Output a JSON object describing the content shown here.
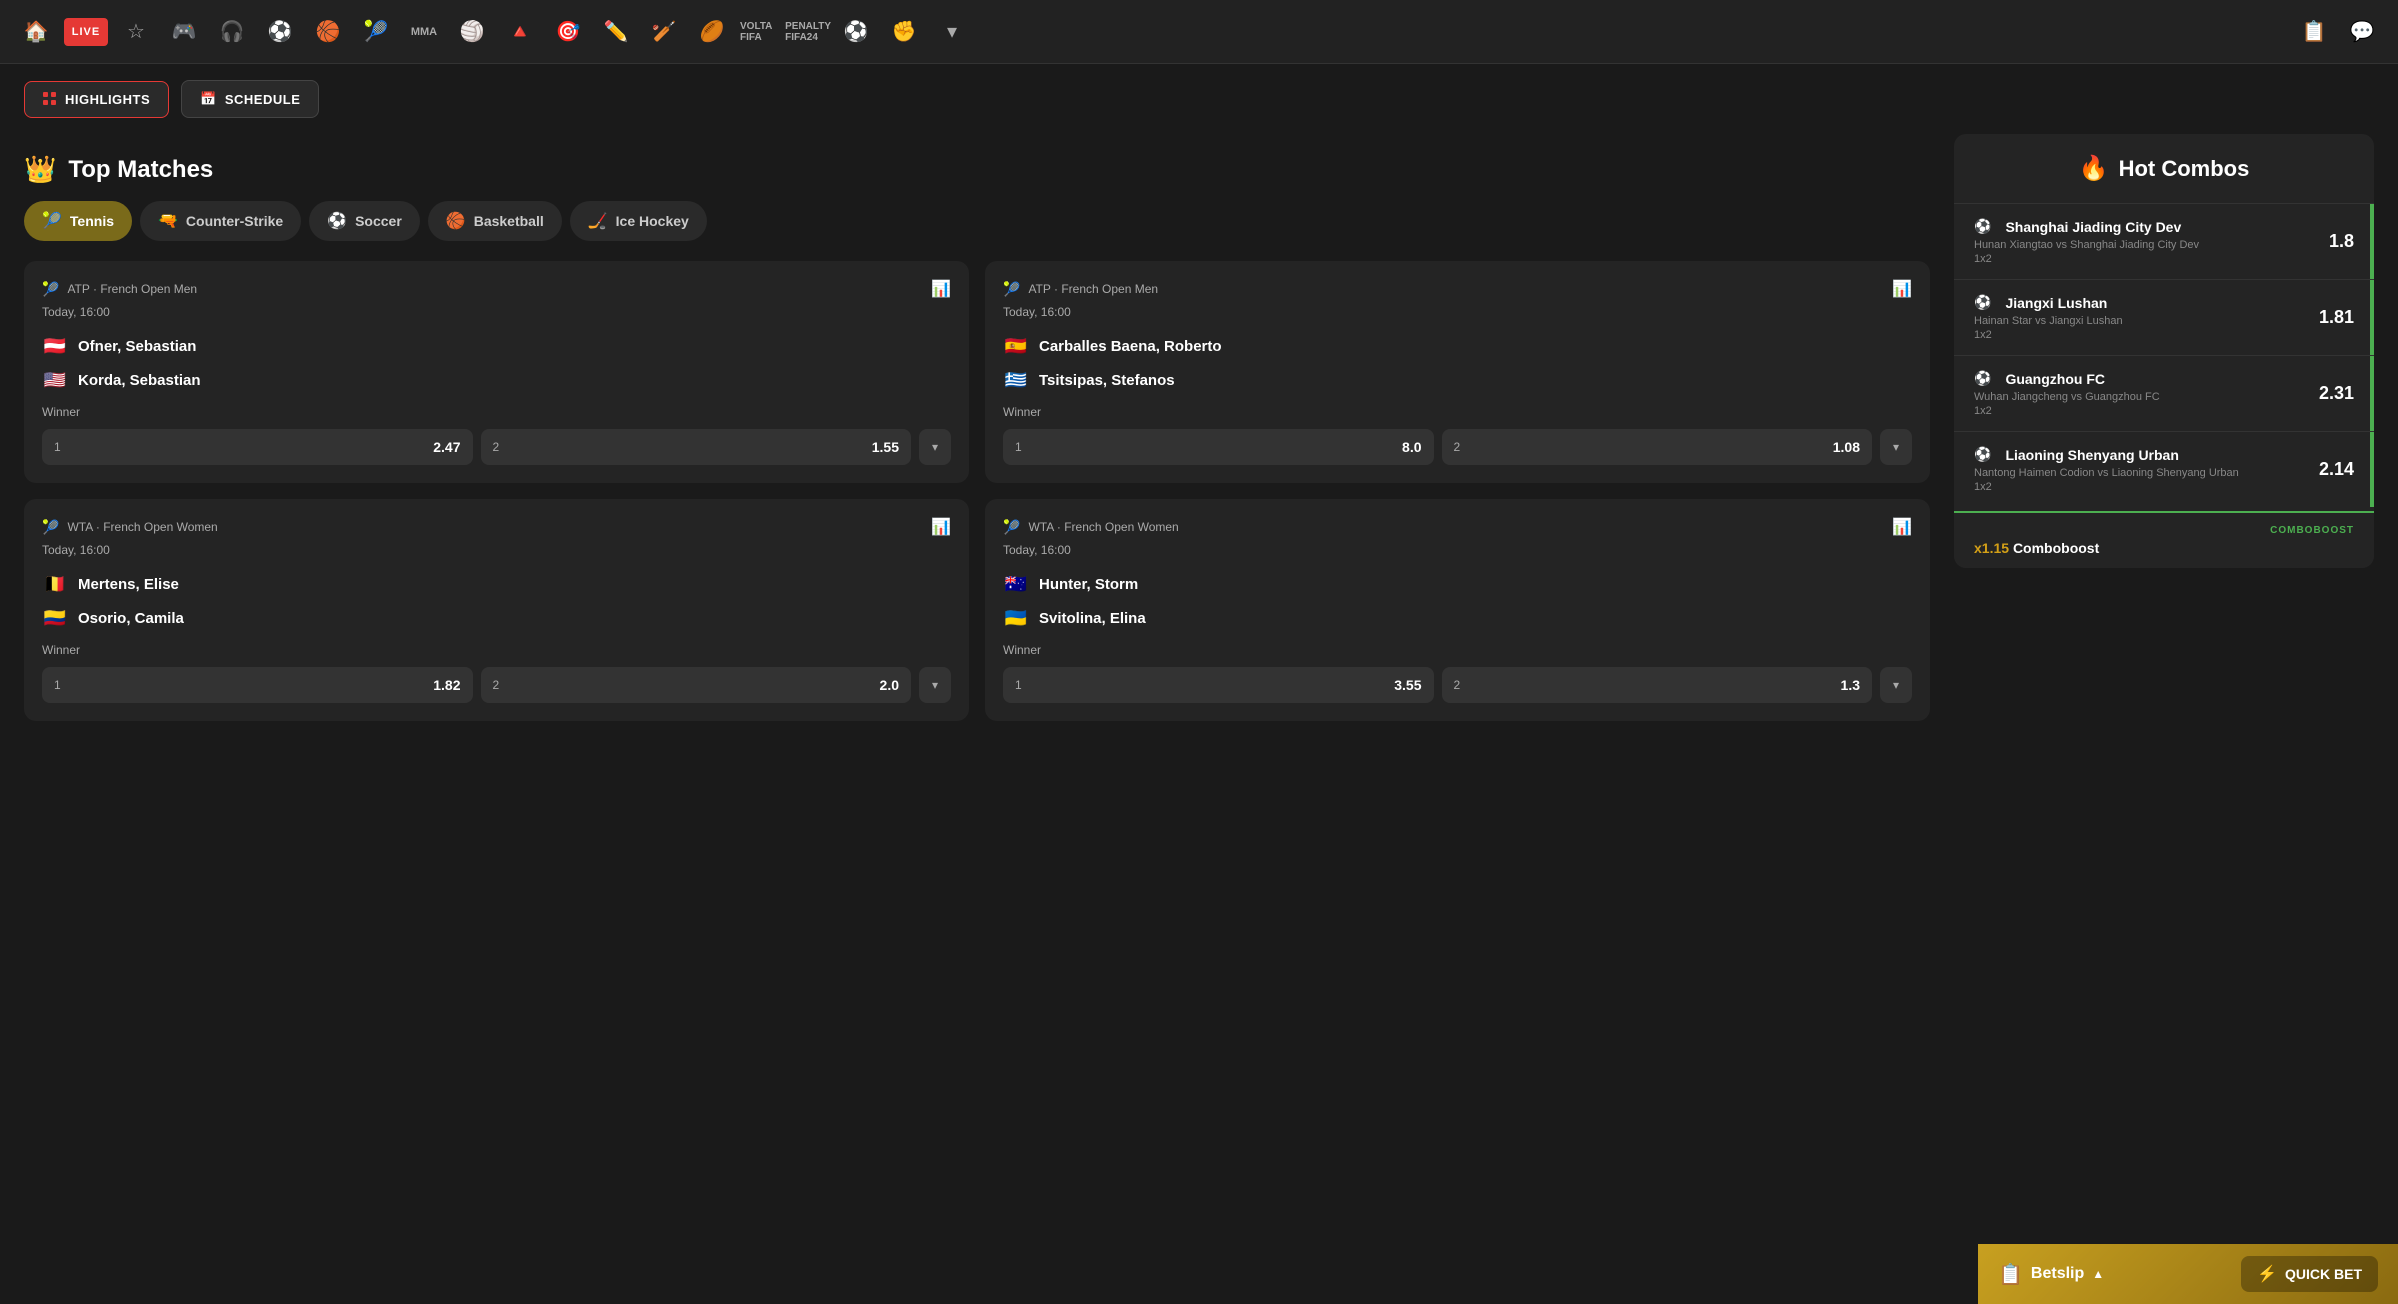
{
  "nav": {
    "live_label": "LIVE",
    "icons": [
      {
        "name": "home-icon",
        "symbol": "🏠"
      },
      {
        "name": "favorites-icon",
        "symbol": "☆"
      },
      {
        "name": "esports-icon",
        "symbol": "🎮"
      },
      {
        "name": "headset-icon",
        "symbol": "🎧"
      },
      {
        "name": "soccer-icon",
        "symbol": "⚽"
      },
      {
        "name": "basketball-icon",
        "symbol": "🏀"
      },
      {
        "name": "tennis-icon",
        "symbol": "🎾"
      },
      {
        "name": "mma-icon",
        "symbol": "MMA"
      },
      {
        "name": "volleyball-icon",
        "symbol": "🏐"
      },
      {
        "name": "snooker-icon",
        "symbol": "🔺"
      },
      {
        "name": "darts-icon",
        "symbol": "🎯"
      },
      {
        "name": "hockey-nav-icon",
        "symbol": "🏒"
      },
      {
        "name": "cricket-icon",
        "symbol": "🏏"
      },
      {
        "name": "rugby-icon",
        "symbol": "🏉"
      },
      {
        "name": "volta-icon",
        "symbol": "VOLTA"
      },
      {
        "name": "penalty-icon",
        "symbol": "FIFA24"
      },
      {
        "name": "extra-icon",
        "symbol": "⚽"
      },
      {
        "name": "fist-icon",
        "symbol": "✊"
      },
      {
        "name": "more-icon",
        "symbol": "▾"
      }
    ],
    "right_icons": [
      {
        "name": "betslip-nav-icon",
        "symbol": "📋"
      },
      {
        "name": "chat-icon",
        "symbol": "💬"
      }
    ]
  },
  "subheader": {
    "highlights_label": "HIGHLIGHTS",
    "schedule_label": "SCHEDULE"
  },
  "top_matches": {
    "title": "Top Matches",
    "tabs": [
      {
        "id": "tennis",
        "label": "Tennis",
        "icon": "🎾",
        "active": true
      },
      {
        "id": "counter-strike",
        "label": "Counter-Strike",
        "icon": "🔫",
        "active": false
      },
      {
        "id": "soccer",
        "label": "Soccer",
        "icon": "⚽",
        "active": false
      },
      {
        "id": "basketball",
        "label": "Basketball",
        "icon": "🏀",
        "active": false
      },
      {
        "id": "ice-hockey",
        "label": "Ice Hockey",
        "icon": "🏒",
        "active": false
      }
    ]
  },
  "matches": [
    {
      "id": "match-1",
      "league": "ATP · French Open Men",
      "time": "Today, 16:00",
      "player1": {
        "name": "Ofner, Sebastian",
        "flag": "🇦🇹"
      },
      "player2": {
        "name": "Korda, Sebastian",
        "flag": "🇺🇸"
      },
      "market": "Winner",
      "odds": [
        {
          "label": "1",
          "value": "2.47"
        },
        {
          "label": "2",
          "value": "1.55"
        }
      ]
    },
    {
      "id": "match-2",
      "league": "ATP · French Open Men",
      "time": "Today, 16:00",
      "player1": {
        "name": "Carballes Baena, Roberto",
        "flag": "🇪🇸"
      },
      "player2": {
        "name": "Tsitsipas, Stefanos",
        "flag": "🇬🇷"
      },
      "market": "Winner",
      "odds": [
        {
          "label": "1",
          "value": "8.0"
        },
        {
          "label": "2",
          "value": "1.08"
        }
      ]
    },
    {
      "id": "match-3",
      "league": "WTA · French Open Women",
      "time": "Today, 16:00",
      "player1": {
        "name": "Mertens, Elise",
        "flag": "🇧🇪"
      },
      "player2": {
        "name": "Osorio, Camila",
        "flag": "🇨🇴"
      },
      "market": "Winner",
      "odds": [
        {
          "label": "1",
          "value": "1.82"
        },
        {
          "label": "2",
          "value": "2.0"
        }
      ]
    },
    {
      "id": "match-4",
      "league": "WTA · French Open Women",
      "time": "Today, 16:00",
      "player1": {
        "name": "Hunter, Storm",
        "flag": "🇦🇺"
      },
      "player2": {
        "name": "Svitolina, Elina",
        "flag": "🇺🇦"
      },
      "market": "Winner",
      "odds": [
        {
          "label": "1",
          "value": "3.55"
        },
        {
          "label": "2",
          "value": "1.3"
        }
      ]
    }
  ],
  "hot_combos": {
    "title": "Hot Combos",
    "items": [
      {
        "team": "Shanghai Jiading City Dev",
        "match": "Hunan Xiangtao vs Shanghai Jiading City Dev",
        "type": "1x2",
        "odds": "1.8"
      },
      {
        "team": "Jiangxi Lushan",
        "match": "Hainan Star vs Jiangxi Lushan",
        "type": "1x2",
        "odds": "1.81"
      },
      {
        "team": "Guangzhou FC",
        "match": "Wuhan Jiangcheng vs Guangzhou FC",
        "type": "1x2",
        "odds": "2.31"
      },
      {
        "team": "Liaoning Shenyang Urban",
        "match": "Nantong Haimen Codion vs Liaoning Shenyang Urban",
        "type": "1x2",
        "odds": "2.14"
      }
    ],
    "comboboost_badge": "COMBOBOOST",
    "comboboost_text": "x1.15 Comboboost"
  },
  "betslip": {
    "label": "Betslip",
    "quick_bet_label": "QUICK BET"
  }
}
